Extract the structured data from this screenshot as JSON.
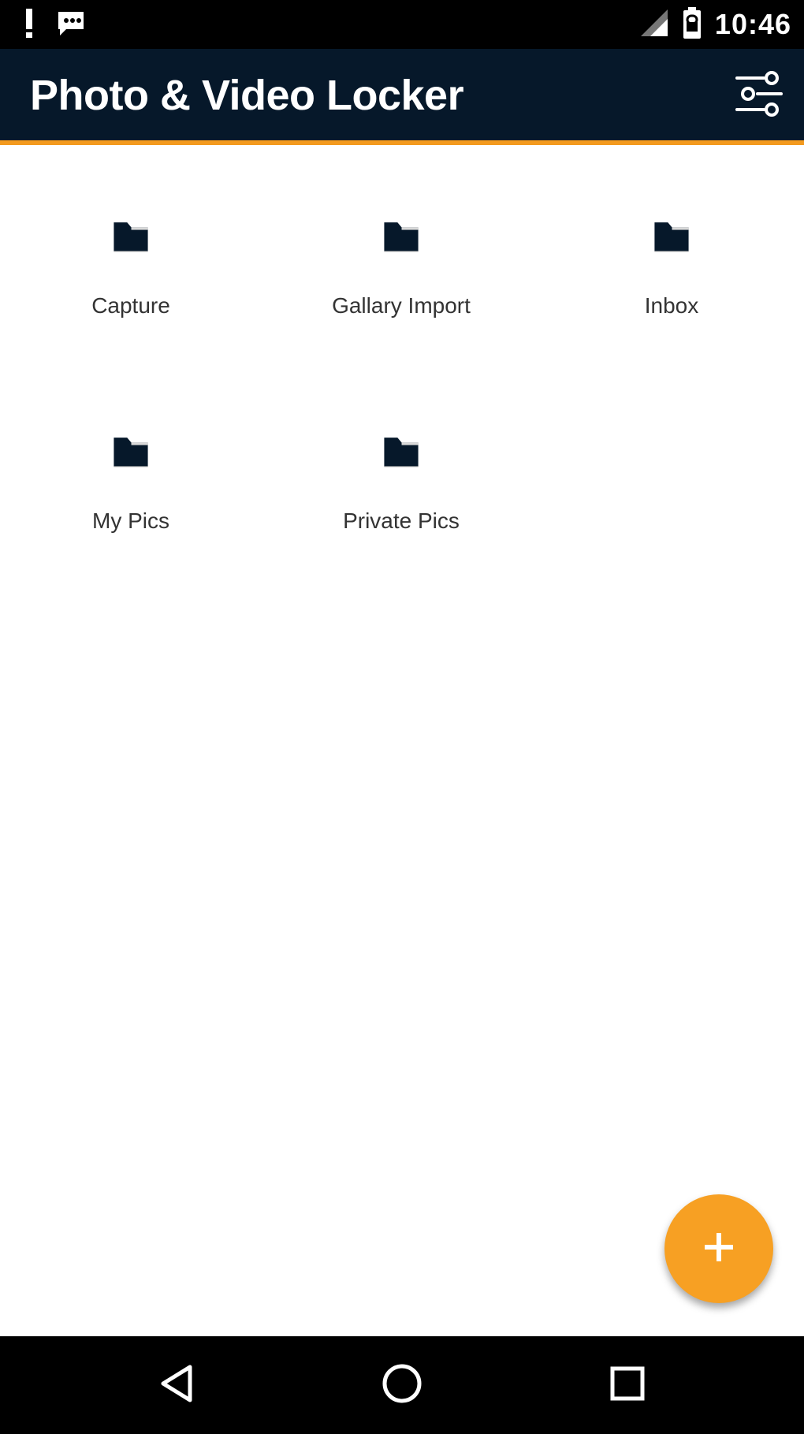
{
  "status_bar": {
    "time": "10:46",
    "icons": [
      "alert-icon",
      "chat-icon",
      "signal-icon",
      "battery-icon"
    ]
  },
  "app_bar": {
    "title": "Photo & Video Locker",
    "settings_icon": "sliders-icon"
  },
  "folders": [
    {
      "label": "Capture",
      "icon": "folder-icon"
    },
    {
      "label": "Gallary Import",
      "icon": "folder-icon"
    },
    {
      "label": "Inbox",
      "icon": "folder-icon"
    },
    {
      "label": "My Pics",
      "icon": "folder-icon"
    },
    {
      "label": "Private Pics",
      "icon": "folder-icon"
    }
  ],
  "fab": {
    "icon": "plus-icon",
    "label": "+"
  },
  "nav_bar": {
    "buttons": [
      "back-icon",
      "home-icon",
      "recents-icon"
    ]
  },
  "colors": {
    "app_bar": "#06182a",
    "accent": "#f39a1e",
    "fab": "#f7a023",
    "folder": "#06182a"
  }
}
